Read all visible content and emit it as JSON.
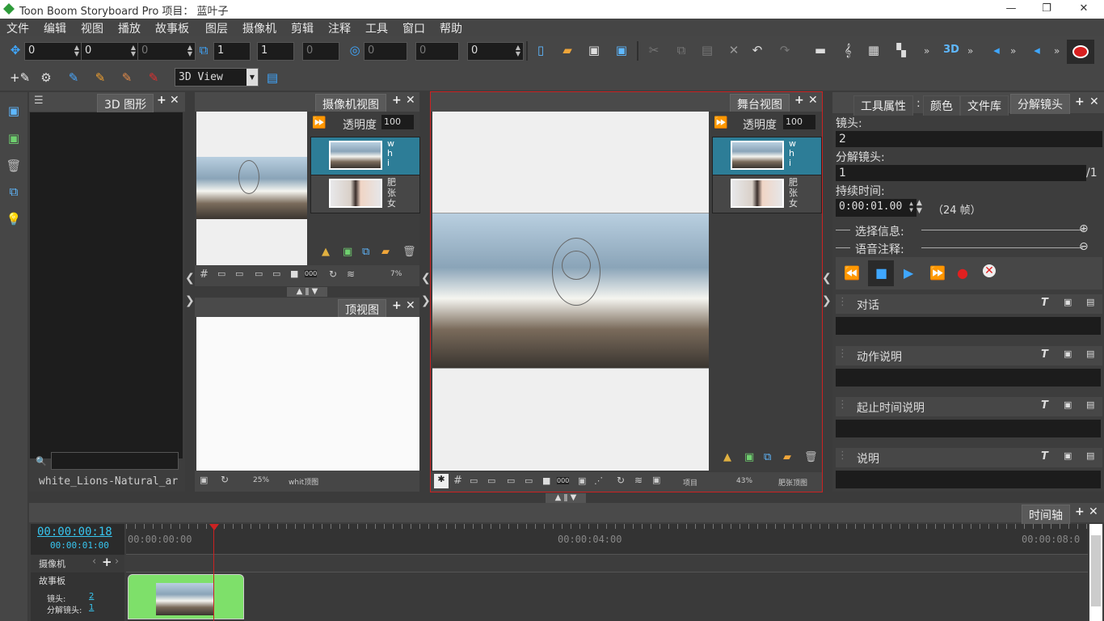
{
  "window": {
    "title": "Toon Boom Storyboard Pro   项目： 蓝叶子",
    "minimize": "—",
    "restore": "❐",
    "close": "✕"
  },
  "menu": [
    "文件",
    "编辑",
    "视图",
    "播放",
    "故事板",
    "图层",
    "摄像机",
    "剪辑",
    "注释",
    "工具",
    "窗口",
    "帮助"
  ],
  "toolbar1": {
    "fields": [
      "0",
      "0",
      "0",
      "1",
      "1",
      "0",
      "0",
      "0",
      "0"
    ],
    "more": "»"
  },
  "toolbar2": {
    "view_select": "3D View"
  },
  "panel_3d": {
    "tab": "3D 图形",
    "footer": "white_Lions-Natural_ar"
  },
  "panel_camera": {
    "tab": "摄像机视图",
    "opacity_label": "透明度",
    "opacity_value": "100",
    "zoom": "7%",
    "layers": [
      {
        "name": "w h i"
      },
      {
        "name": "肥 张 女"
      }
    ]
  },
  "panel_top": {
    "tab": "顶视图",
    "zoom": "25%",
    "footer_name": "whit顶图"
  },
  "panel_stage": {
    "tab": "舞台视图",
    "opacity_label": "透明度",
    "opacity_value": "100",
    "footer_proj": "项目",
    "zoom": "43%",
    "footer_name": "肥张顶图",
    "layers": [
      {
        "name": "w h i"
      },
      {
        "name": "肥 张 女"
      }
    ]
  },
  "right_panel": {
    "tabs": [
      "工具属性",
      "颜色",
      "文件库",
      "分解镜头"
    ],
    "shot_label": "镜头:",
    "shot_value": "2",
    "panel_label": "分解镜头:",
    "panel_value": "1",
    "panel_total": "/1",
    "duration_label": "持续时间:",
    "duration_value": "0:00:01.00",
    "duration_frames": "（24 帧）",
    "selection_info": "选择信息:",
    "voice_notes": "语音注释:",
    "sections": [
      "对话",
      "动作说明",
      "起止时间说明",
      "说明"
    ]
  },
  "timeline": {
    "tab": "时间轴",
    "current_time": "00:00:00:18",
    "duration": "00:00:01:00",
    "ruler": [
      "00:00:00:00",
      "00:00:04:00",
      "00:00:08:0"
    ],
    "camera_track": "摄像机",
    "storyboard_track": "故事板",
    "shot_label": "镜头:",
    "shot_value": "2",
    "panel_label": "分解镜头:",
    "panel_value": "1"
  },
  "colors": {
    "accent_red": "#cc2222",
    "layer_selected": "#2d7d97",
    "clip_green": "#7ee06a",
    "time_cyan": "#37c6f0"
  }
}
